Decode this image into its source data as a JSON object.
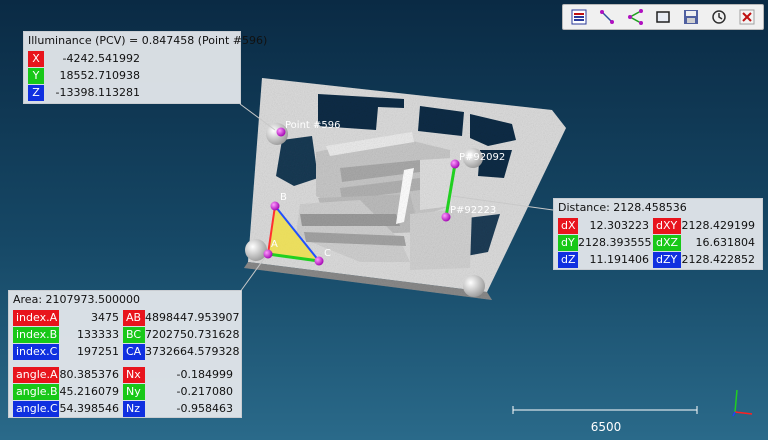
{
  "toolbar": {
    "buttons": [
      {
        "icon": "list-icon"
      },
      {
        "icon": "point-pick-icon"
      },
      {
        "icon": "segment-pick-icon"
      },
      {
        "icon": "rectangle-pick-icon"
      },
      {
        "icon": "save-icon"
      },
      {
        "icon": "restore-icon"
      },
      {
        "icon": "close-icon"
      }
    ]
  },
  "point_panel": {
    "title": "Illuminance (PCV) = 0.847458 (Point #596)",
    "rows": [
      {
        "label": "X",
        "value": "-4242.541992"
      },
      {
        "label": "Y",
        "value": "18552.710938"
      },
      {
        "label": "Z",
        "value": "-13398.113281"
      }
    ]
  },
  "distance_panel": {
    "title": "Distance: 2128.458536",
    "rows": [
      {
        "l1": "dX",
        "v1": "12.303223",
        "l2": "dXY",
        "v2": "2128.429199"
      },
      {
        "l1": "dY",
        "v1": "2128.393555",
        "l2": "dXZ",
        "v2": "16.631804"
      },
      {
        "l1": "dZ",
        "v1": "11.191406",
        "l2": "dZY",
        "v2": "2128.422852"
      }
    ]
  },
  "area_panel": {
    "title": "Area: 2107973.500000",
    "rows": [
      {
        "l1": "index.A",
        "v1": "3475",
        "l2": "AB",
        "v2": "4898447.953907"
      },
      {
        "l1": "index.B",
        "v1": "133333",
        "l2": "BC",
        "v2": "7202750.731628"
      },
      {
        "l1": "index.C",
        "v1": "197251",
        "l2": "CA",
        "v2": "3732664.579328"
      },
      {
        "l1": "angle.A",
        "v1": "80.385376",
        "l2": "Nx",
        "v2": "-0.184999"
      },
      {
        "l1": "angle.B",
        "v1": "45.216079",
        "l2": "Ny",
        "v2": "-0.217080"
      },
      {
        "l1": "angle.C",
        "v1": "54.398546",
        "l2": "Nz",
        "v2": "-0.958463"
      }
    ]
  },
  "point_labels": {
    "p596": "Point #596",
    "p92092": "P#92092",
    "p92223": "P#92223",
    "a": "A",
    "b": "B",
    "c": "C"
  },
  "scale_bar": {
    "label": "6500"
  },
  "colors": {
    "x": "#e8141c",
    "y": "#18c818",
    "z": "#1030e0",
    "selection": "#f0e040"
  }
}
